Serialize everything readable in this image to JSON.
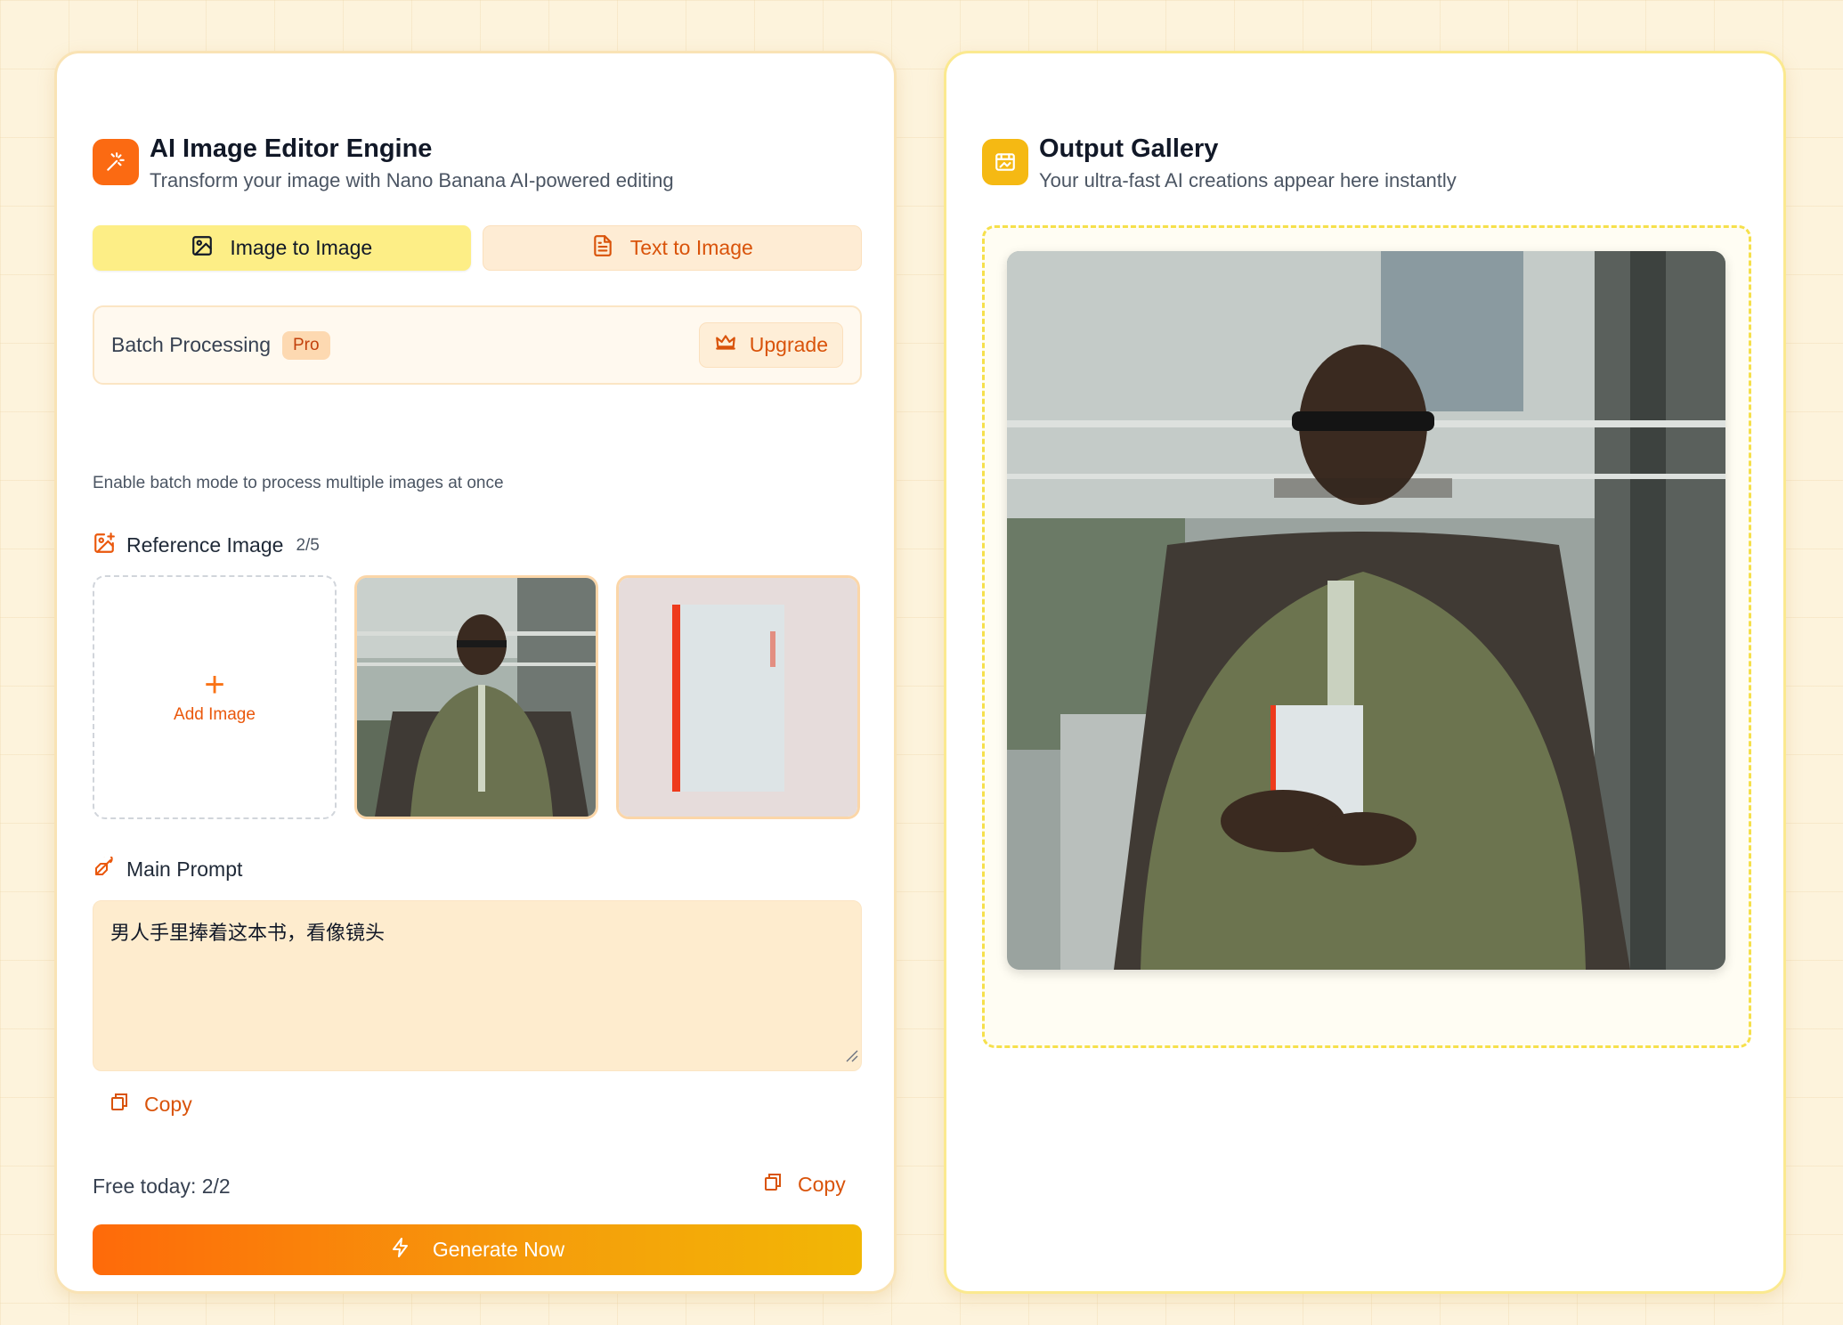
{
  "editor": {
    "title": "AI Image Editor Engine",
    "subtitle": "Transform your image with Nano Banana AI-powered editing",
    "tabs": [
      {
        "label": "Image to Image",
        "active": true,
        "icon": "image-icon"
      },
      {
        "label": "Text to Image",
        "active": false,
        "icon": "document-icon"
      }
    ],
    "batch": {
      "label": "Batch Processing",
      "badge": "Pro",
      "upgrade_label": "Upgrade",
      "hint": "Enable batch mode to process multiple images at once"
    },
    "reference": {
      "label": "Reference Image",
      "count": "2/5",
      "add_label": "Add Image",
      "thumbnails": [
        "man-in-olive-outfit-photo",
        "white-book-photo"
      ]
    },
    "prompt": {
      "label": "Main Prompt",
      "value": "男人手里捧着这本书，看像镜头",
      "copy_label": "Copy"
    },
    "footer": {
      "free_today": "Free today: 2/2",
      "copy_label": "Copy",
      "generate_label": "Generate Now"
    }
  },
  "gallery": {
    "title": "Output Gallery",
    "subtitle": "Your ultra-fast AI creations appear here instantly",
    "result_image": "man-holding-book-photo"
  },
  "colors": {
    "accent_orange": "#fb6a12",
    "accent_yellow": "#f5b913",
    "active_tab": "#fdee86",
    "page_background": "#fdf3dc"
  }
}
